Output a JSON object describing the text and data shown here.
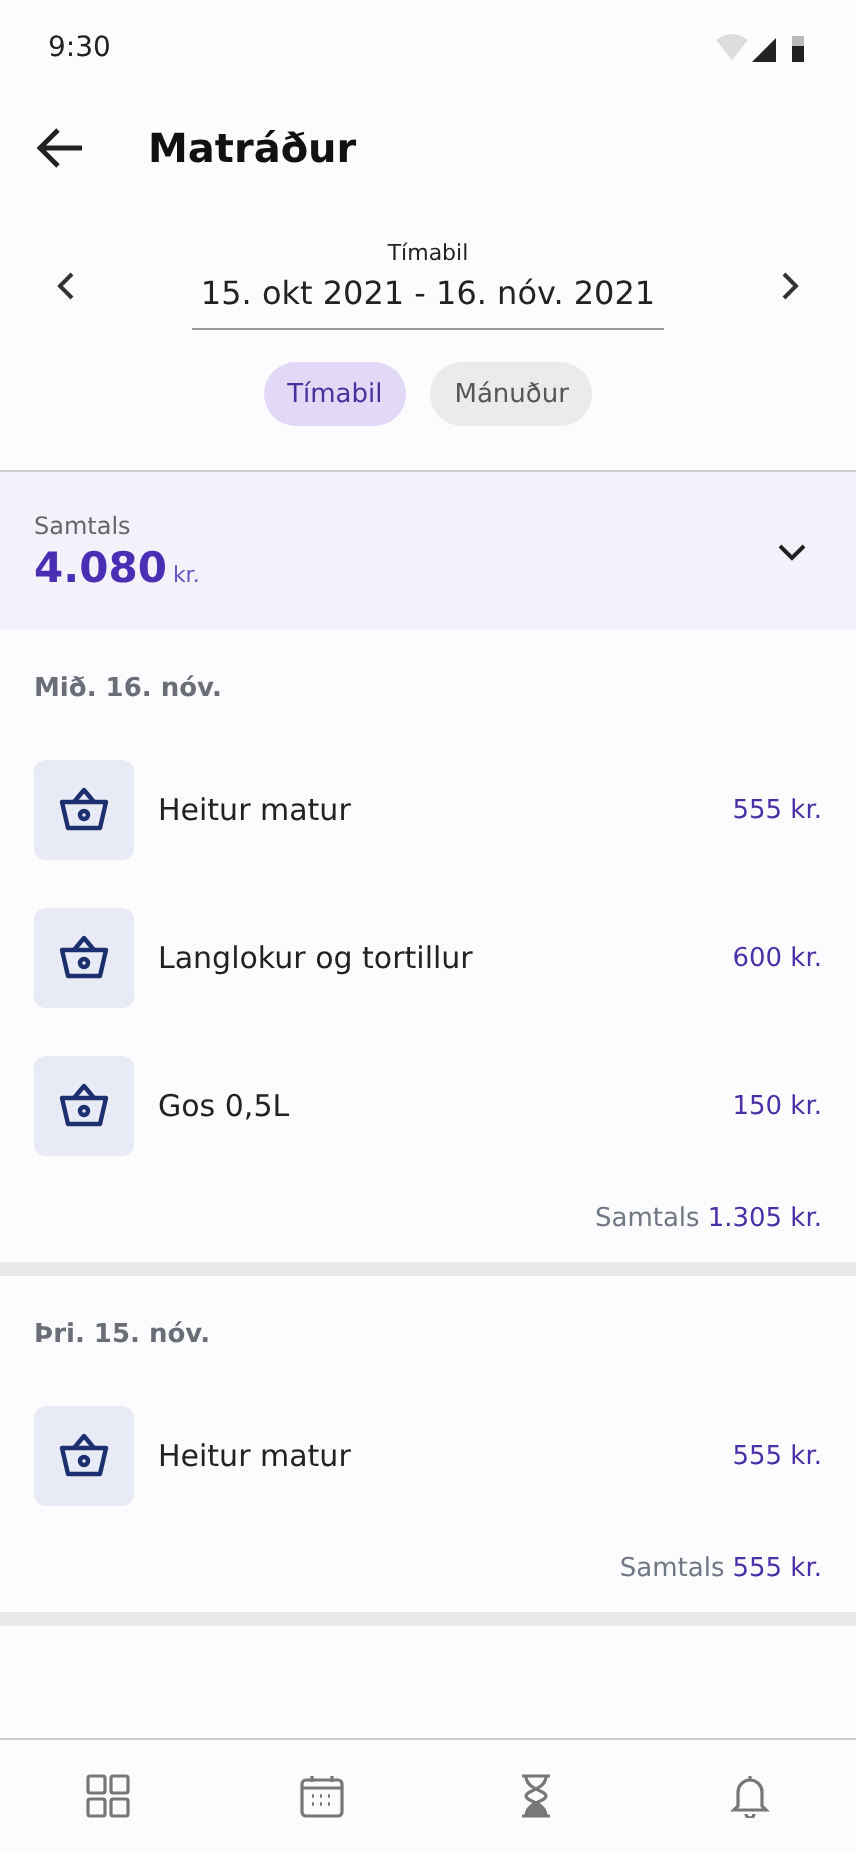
{
  "status_bar": {
    "time": "9:30"
  },
  "header": {
    "title": "Matráður"
  },
  "period": {
    "label": "Tímabil",
    "value": "15. okt 2021 - 16. nóv. 2021"
  },
  "tabs": [
    {
      "label": "Tímabil",
      "selected": true
    },
    {
      "label": "Mánuður",
      "selected": false
    }
  ],
  "summary": {
    "label": "Samtals",
    "amount": "4.080",
    "unit": "kr.",
    "expanded": false
  },
  "days": [
    {
      "date": "Mið. 16. nóv.",
      "items": [
        {
          "name": "Heitur matur",
          "price": "555 kr."
        },
        {
          "name": "Langlokur og tortillur",
          "price": "600 kr."
        },
        {
          "name": "Gos 0,5L",
          "price": "150 kr."
        }
      ],
      "total_label": "Samtals",
      "total": "1.305 kr."
    },
    {
      "date": "Þri. 15. nóv.",
      "items": [
        {
          "name": "Heitur matur",
          "price": "555 kr."
        }
      ],
      "total_label": "Samtals",
      "total": "555 kr."
    }
  ],
  "bottom_nav": [
    {
      "kind": "grid"
    },
    {
      "kind": "calendar"
    },
    {
      "kind": "hourglass"
    },
    {
      "kind": "bell"
    }
  ]
}
